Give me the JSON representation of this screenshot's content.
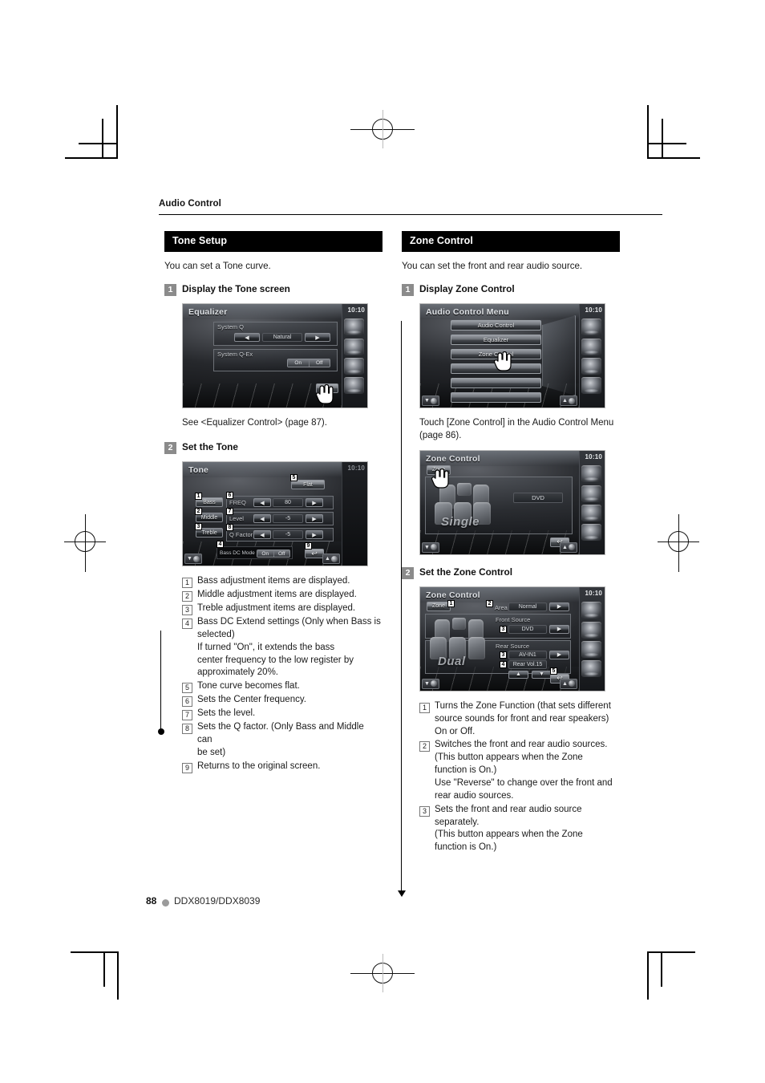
{
  "page": {
    "running_head": "Audio Control",
    "footer_page_number": "88",
    "footer_model": "DDX8019/DDX8039"
  },
  "left_column": {
    "section_title": "Tone Setup",
    "intro": "You can set a Tone curve.",
    "step1": {
      "num": "1",
      "label": "Display the Tone screen"
    },
    "note_after_step1": "See <Equalizer Control> (page 87).",
    "step2": {
      "num": "2",
      "label": "Set the Tone"
    },
    "equalizer_screen": {
      "title": "Equalizer",
      "clock": "10:10",
      "system_q_label": "System Q",
      "system_q_value": "Natural",
      "prev_arrow": "◀",
      "next_arrow": "▶",
      "system_q_ex_label": "System Q-Ex",
      "on_label": "On",
      "off_label": "Off"
    },
    "tone_screen": {
      "title": "Tone",
      "clock": "10:10",
      "flat_label": "Flat",
      "bass_label": "Bass",
      "middle_label": "Middle",
      "treble_label": "Treble",
      "freq_label": "FREQ",
      "freq_value": "80",
      "level_label": "Level",
      "level_value": "-5",
      "q_factor_label": "Q Factor",
      "q_factor_value": "-5",
      "bass_dc_label": "Bass DC Mode",
      "on_label": "On",
      "off_label": "Off",
      "prev_arrow": "◀",
      "next_arrow": "▶",
      "return_arrow": "↩",
      "callouts": [
        "1",
        "2",
        "3",
        "4",
        "5",
        "6",
        "7",
        "8",
        "9"
      ]
    },
    "explanations": [
      {
        "num": "1",
        "lines": [
          "Bass adjustment items are displayed."
        ]
      },
      {
        "num": "2",
        "lines": [
          "Middle adjustment items are displayed."
        ]
      },
      {
        "num": "3",
        "lines": [
          "Treble adjustment items are displayed."
        ]
      },
      {
        "num": "4",
        "lines": [
          "Bass DC Extend settings (Only when Bass is",
          "selected)",
          "If turned \"On\", it extends the bass",
          "center frequency to the low register by",
          "approximately 20%."
        ]
      },
      {
        "num": "5",
        "lines": [
          "Tone curve becomes flat."
        ]
      },
      {
        "num": "6",
        "lines": [
          "Sets the Center frequency."
        ]
      },
      {
        "num": "7",
        "lines": [
          "Sets the level."
        ]
      },
      {
        "num": "8",
        "lines": [
          "Sets the Q factor. (Only Bass and Middle can",
          "be set)"
        ]
      },
      {
        "num": "9",
        "lines": [
          "Returns to the original screen."
        ]
      }
    ]
  },
  "right_column": {
    "section_title": "Zone Control",
    "intro": "You can set the front and rear audio source.",
    "step1": {
      "num": "1",
      "label": "Display Zone Control"
    },
    "note_after_step1": "Touch [Zone Control] in the Audio Control Menu (page 86).",
    "step2": {
      "num": "2",
      "label": "Set the Zone Control"
    },
    "audio_menu_screen": {
      "title": "Audio Control Menu",
      "clock": "10:10",
      "items": [
        "Audio Control",
        "Equalizer",
        "Zone Control",
        "",
        "",
        ""
      ]
    },
    "zone_single_screen": {
      "title": "Zone Control",
      "clock": "10:10",
      "zone_button": "Zone",
      "mode_word": "Single",
      "source_value": "DVD",
      "return_arrow": "↩"
    },
    "zone_dual_screen": {
      "title": "Zone Control",
      "clock": "10:10",
      "zone_button": "Zone",
      "mode_word": "Dual",
      "area_label": "Area",
      "area_value": "Normal",
      "front_source_label": "Front Source",
      "front_source_value": "DVD",
      "rear_source_label": "Rear Source",
      "rear_source_value": "AV-IN1",
      "rear_vol_value": "Rear Vol.15",
      "next_arrow": "▶",
      "up_arrow": "▲",
      "down_arrow": "▼",
      "return_arrow": "↩",
      "callouts": [
        "1",
        "2",
        "3",
        "3",
        "4",
        "5"
      ]
    },
    "explanations": [
      {
        "num": "1",
        "lines": [
          "Turns the Zone Function (that sets different",
          "source sounds for front and rear speakers)",
          "On or Off."
        ]
      },
      {
        "num": "2",
        "lines": [
          "Switches the front and rear audio sources.",
          "(This button appears when the Zone",
          "function is On.)",
          "Use \"Reverse\" to change over the front and",
          "rear audio sources."
        ]
      },
      {
        "num": "3",
        "lines": [
          "Sets the front and rear audio source",
          "separately.",
          "(This button appears when the Zone",
          "function is On.)"
        ]
      }
    ]
  }
}
